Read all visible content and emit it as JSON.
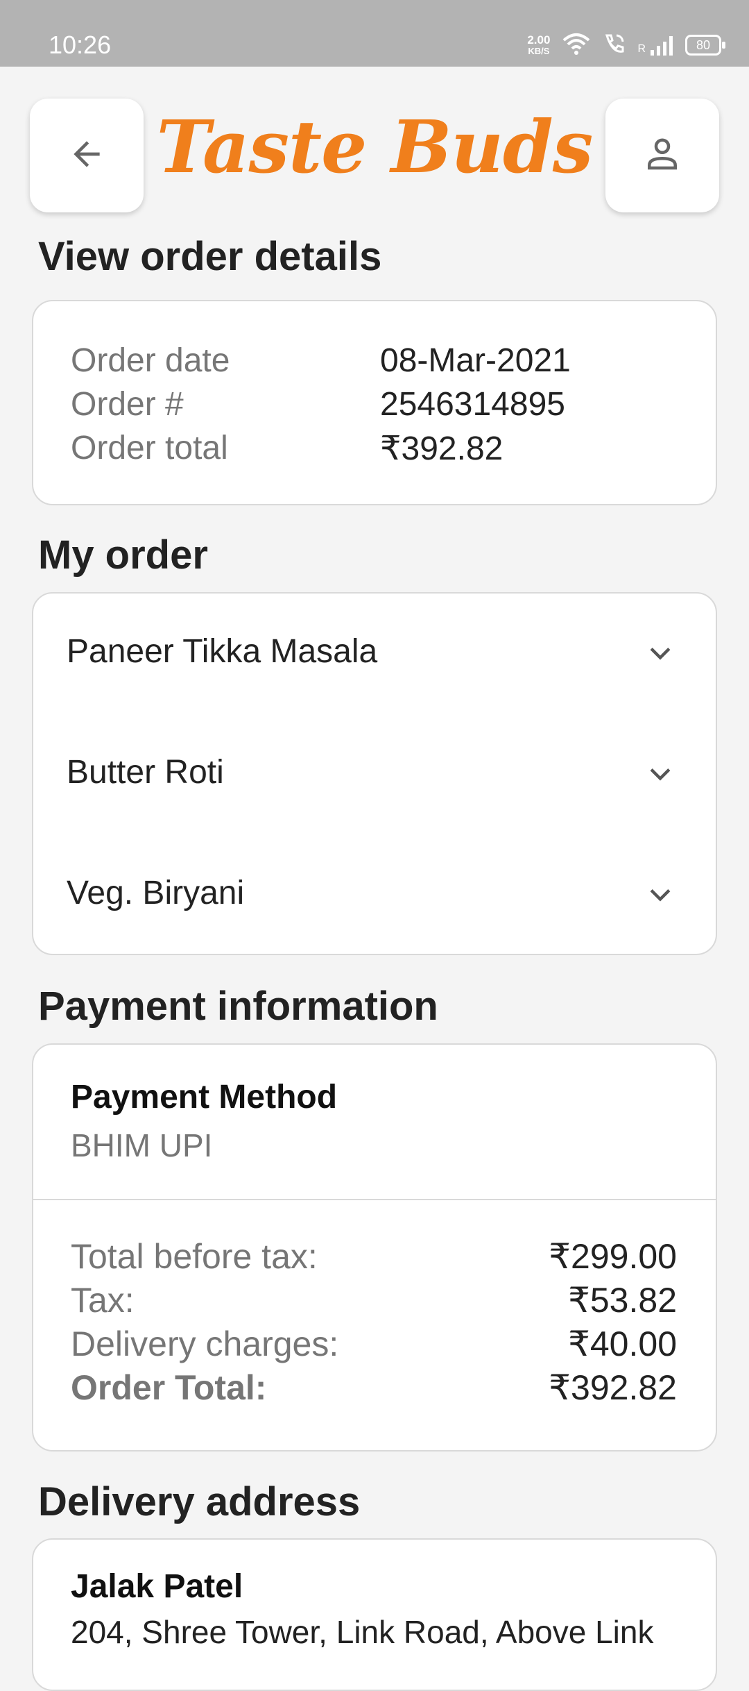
{
  "status_bar": {
    "time": "10:26",
    "net_speed_value": "2.00",
    "net_speed_unit": "KB/S",
    "signal_label": "R",
    "battery": "80"
  },
  "header": {
    "back_icon": "arrow-left-icon",
    "profile_icon": "user-icon",
    "logo_text": "Taste Buds",
    "brand_color": "#f07f1c"
  },
  "page_title": "View order details",
  "order_summary": {
    "rows": [
      {
        "label": "Order date",
        "value": "08-Mar-2021"
      },
      {
        "label": "Order #",
        "value": "2546314895"
      },
      {
        "label": "Order total",
        "value": "₹392.82"
      }
    ]
  },
  "my_order": {
    "title": "My order",
    "items": [
      {
        "name": "Paneer Tikka Masala"
      },
      {
        "name": "Butter Roti"
      },
      {
        "name": "Veg. Biryani"
      }
    ]
  },
  "payment": {
    "title": "Payment information",
    "method_label": "Payment Method",
    "method_value": "BHIM UPI",
    "totals": [
      {
        "label": "Total before tax:",
        "value": "₹299.00"
      },
      {
        "label": "Tax:",
        "value": "₹53.82"
      },
      {
        "label": "Delivery charges:",
        "value": "₹40.00"
      },
      {
        "label": "Order Total:",
        "value": "₹392.82"
      }
    ]
  },
  "delivery": {
    "title": "Delivery address",
    "name": "Jalak Patel",
    "address_line": "204, Shree Tower, Link Road, Above Link"
  }
}
